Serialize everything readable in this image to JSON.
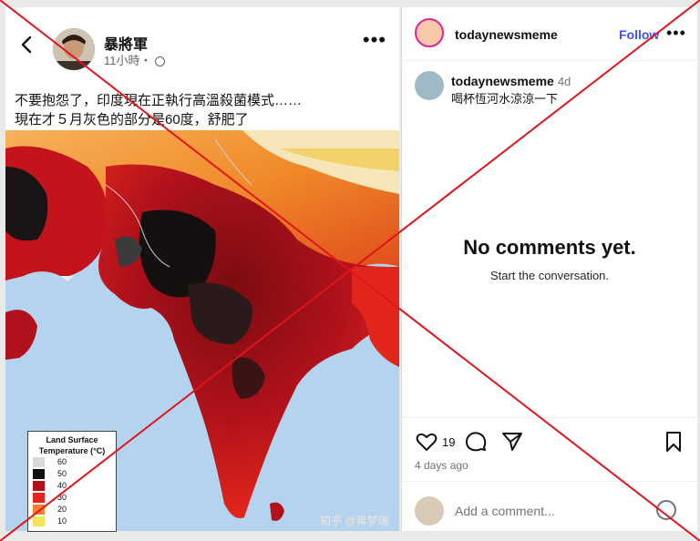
{
  "post": {
    "author": "暴將軍",
    "time": "11小時・",
    "caption_line1": "不要抱怨了，印度現在正執行高溫殺菌模式……",
    "caption_line2": "現在才５月灰色的部分是60度，舒肥了",
    "legend": {
      "title": "Land Surface Temperature (°C)",
      "levels": [
        {
          "value": "60",
          "color": "#d9d9d9"
        },
        {
          "value": "50",
          "color": "#111111"
        },
        {
          "value": "40",
          "color": "#b0111b"
        },
        {
          "value": "30",
          "color": "#e3261b"
        },
        {
          "value": "20",
          "color": "#f57f2a"
        },
        {
          "value": "10",
          "color": "#f6e35a"
        }
      ]
    },
    "watermark": "知乎 @蒋梦瑞"
  },
  "panel": {
    "username": "todaynewsmeme",
    "follow": "Follow",
    "comment_user": "todaynewsmeme",
    "comment_age": "4d",
    "comment_text": "喝杯恆河水涼涼一下",
    "empty_title": "No comments yet.",
    "empty_sub": "Start the conversation.",
    "likes": "19",
    "posted": "4 days ago",
    "add_comment_placeholder": "Add a comment..."
  },
  "colors": {
    "cross": "#e1141b",
    "follow": "#4150f7",
    "ocean": "#b4d3ee"
  },
  "icons": [
    "back-arrow-icon",
    "globe-icon",
    "more-icon",
    "heart-icon",
    "comment-icon",
    "share-icon",
    "bookmark-icon",
    "emoji-icon"
  ]
}
